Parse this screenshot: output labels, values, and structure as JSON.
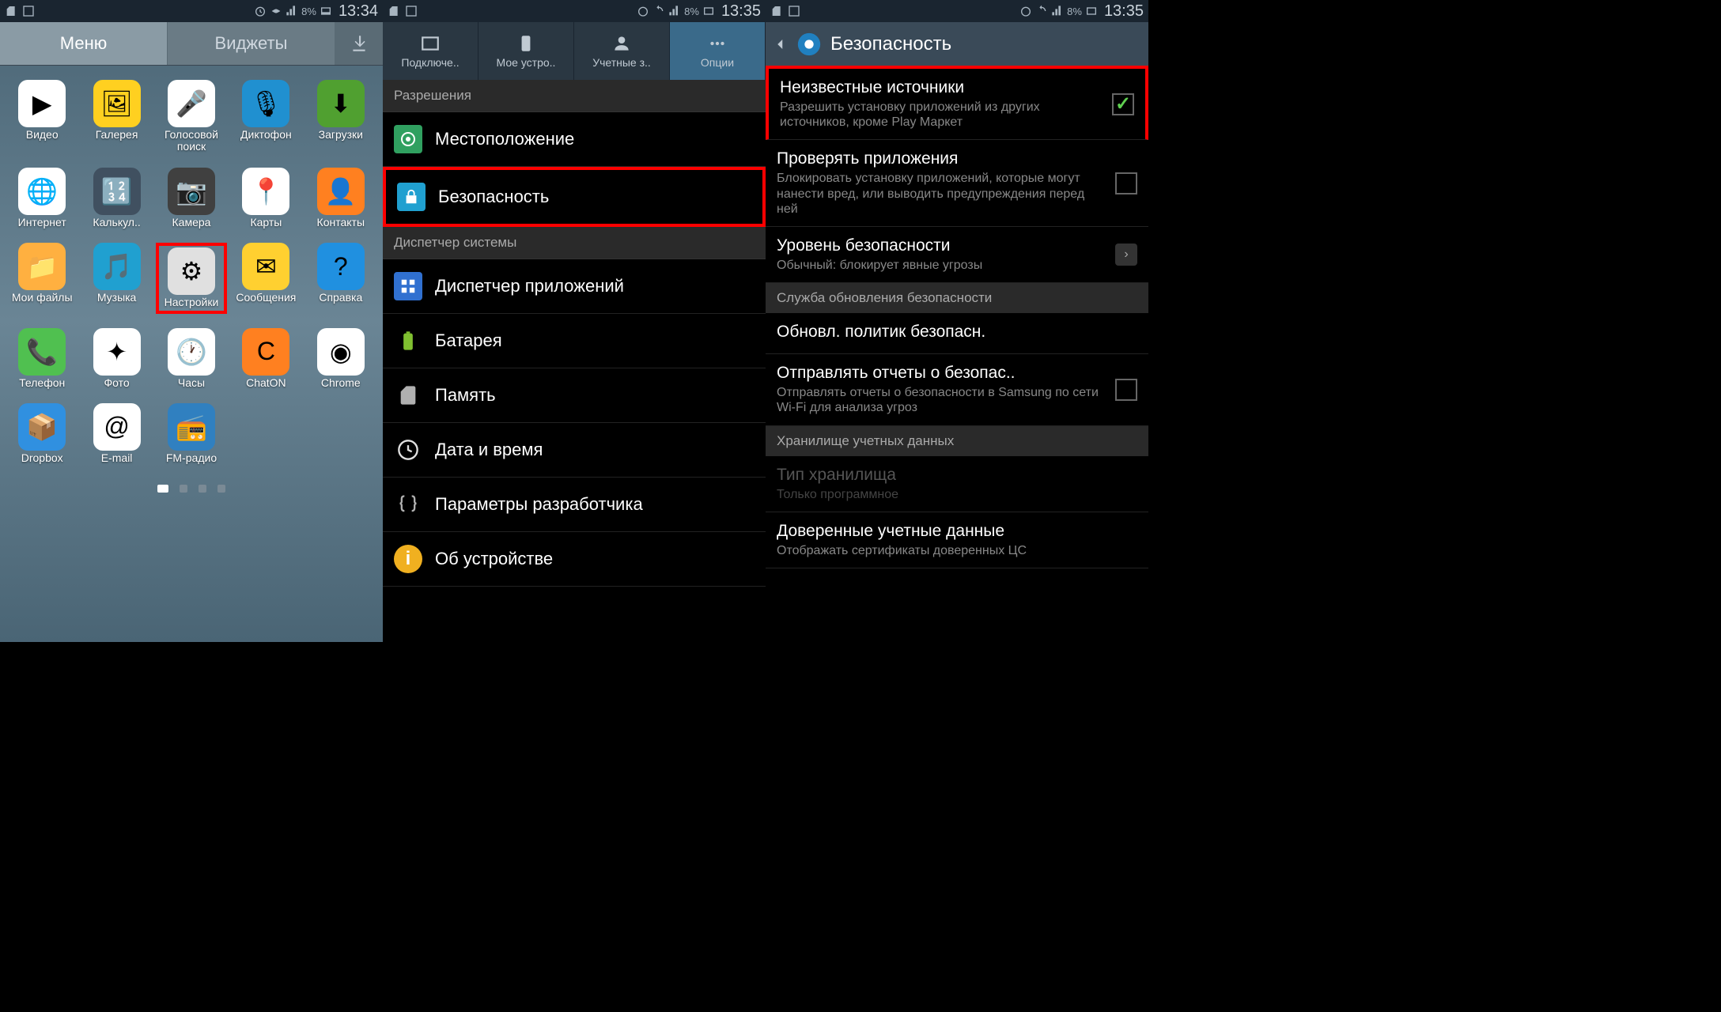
{
  "status": {
    "time1": "13:34",
    "time2": "13:35",
    "time3": "13:35",
    "battery": "8%"
  },
  "p1": {
    "tab_menu": "Меню",
    "tab_widgets": "Виджеты",
    "apps": [
      {
        "label": "Видео",
        "bg": "#fff",
        "emoji": "▶"
      },
      {
        "label": "Галерея",
        "bg": "#ffd020",
        "emoji": "🖼"
      },
      {
        "label": "Голосовой поиск",
        "bg": "#fff",
        "emoji": "🎤"
      },
      {
        "label": "Диктофон",
        "bg": "#2090d0",
        "emoji": "🎙"
      },
      {
        "label": "Загрузки",
        "bg": "#50a030",
        "emoji": "⬇"
      },
      {
        "label": "Интернет",
        "bg": "#fff",
        "emoji": "🌐"
      },
      {
        "label": "Калькул..",
        "bg": "#405060",
        "emoji": "🔢"
      },
      {
        "label": "Камера",
        "bg": "#404040",
        "emoji": "📷"
      },
      {
        "label": "Карты",
        "bg": "#fff",
        "emoji": "📍"
      },
      {
        "label": "Контакты",
        "bg": "#ff8020",
        "emoji": "👤"
      },
      {
        "label": "Мои файлы",
        "bg": "#ffb040",
        "emoji": "📁"
      },
      {
        "label": "Музыка",
        "bg": "#20a0d0",
        "emoji": "🎵"
      },
      {
        "label": "Настройки",
        "bg": "#e0e0e0",
        "emoji": "⚙",
        "hl": true
      },
      {
        "label": "Сообщения",
        "bg": "#ffd030",
        "emoji": "✉"
      },
      {
        "label": "Справка",
        "bg": "#2090e0",
        "emoji": "?"
      },
      {
        "label": "Телефон",
        "bg": "#50c050",
        "emoji": "📞"
      },
      {
        "label": "Фото",
        "bg": "#fff",
        "emoji": "✦"
      },
      {
        "label": "Часы",
        "bg": "#fff",
        "emoji": "🕐"
      },
      {
        "label": "ChatON",
        "bg": "#ff8020",
        "emoji": "C"
      },
      {
        "label": "Chrome",
        "bg": "#fff",
        "emoji": "◉"
      },
      {
        "label": "Dropbox",
        "bg": "#3090e0",
        "emoji": "📦"
      },
      {
        "label": "E-mail",
        "bg": "#fff",
        "emoji": "@"
      },
      {
        "label": "FM-радио",
        "bg": "#3080c0",
        "emoji": "📻"
      }
    ]
  },
  "p2": {
    "tabs": [
      {
        "label": "Подключе.."
      },
      {
        "label": "Мое устро.."
      },
      {
        "label": "Учетные з.."
      },
      {
        "label": "Опции",
        "active": true
      }
    ],
    "sec_permissions": "Разрешения",
    "row_location": "Местоположение",
    "row_security": "Безопасность",
    "sec_system": "Диспетчер системы",
    "row_apps": "Диспетчер приложений",
    "row_battery": "Батарея",
    "row_storage": "Память",
    "row_datetime": "Дата и время",
    "row_dev": "Параметры разработчика",
    "row_about": "Об устройстве"
  },
  "p3": {
    "title": "Безопасность",
    "i1_t": "Неизвестные источники",
    "i1_s": "Разрешить установку приложений из других источников, кроме Play Маркет",
    "i2_t": "Проверять приложения",
    "i2_s": "Блокировать установку приложений, которые могут нанести вред, или выводить предупреждения перед ней",
    "i3_t": "Уровень безопасности",
    "i3_s": "Обычный: блокирует явные угрозы",
    "sec_update": "Служба обновления безопасности",
    "i4_t": "Обновл. политик безопасн.",
    "i5_t": "Отправлять отчеты о безопас..",
    "i5_s": "Отправлять отчеты о безопасности в Samsung по сети Wi-Fi для анализа угроз",
    "sec_cred": "Хранилище учетных данных",
    "i6_t": "Тип хранилища",
    "i6_s": "Только программное",
    "i7_t": "Доверенные учетные данные",
    "i7_s": "Отображать сертификаты доверенных ЦС"
  }
}
